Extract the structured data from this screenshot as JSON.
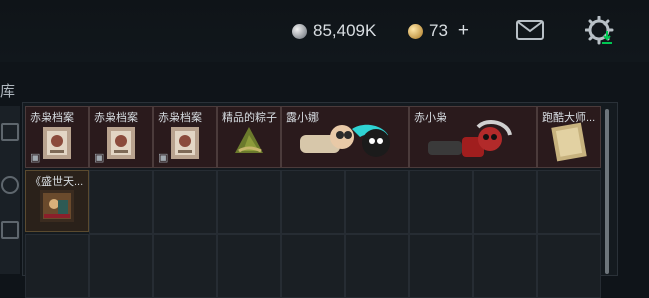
{
  "header": {
    "silver_amount": "85,409K",
    "gold_amount": "73",
    "plus_label": "+"
  },
  "warehouse": {
    "label": "库"
  },
  "items": [
    {
      "name": "赤枭档案",
      "locked": true
    },
    {
      "name": "赤枭档案",
      "locked": true
    },
    {
      "name": "赤枭档案",
      "locked": true
    },
    {
      "name": "精品的粽子",
      "locked": false
    },
    {
      "name": "露小娜",
      "locked": false
    },
    {
      "name": "赤小枭",
      "locked": false
    },
    {
      "name": "跑酷大师...",
      "locked": false
    },
    {
      "name": "《盛世天...",
      "locked": false
    }
  ],
  "icons": {
    "silver_coin": "silver-coin-icon",
    "gold_coin": "gold-coin-icon",
    "mail": "mail-icon",
    "settings": "gear-icon",
    "lock": "lock-icon"
  },
  "colors": {
    "background": "#0f1419",
    "grid_bg": "#141a1f",
    "item_bg": "#2a1a1c",
    "accent_green": "#00c853"
  }
}
